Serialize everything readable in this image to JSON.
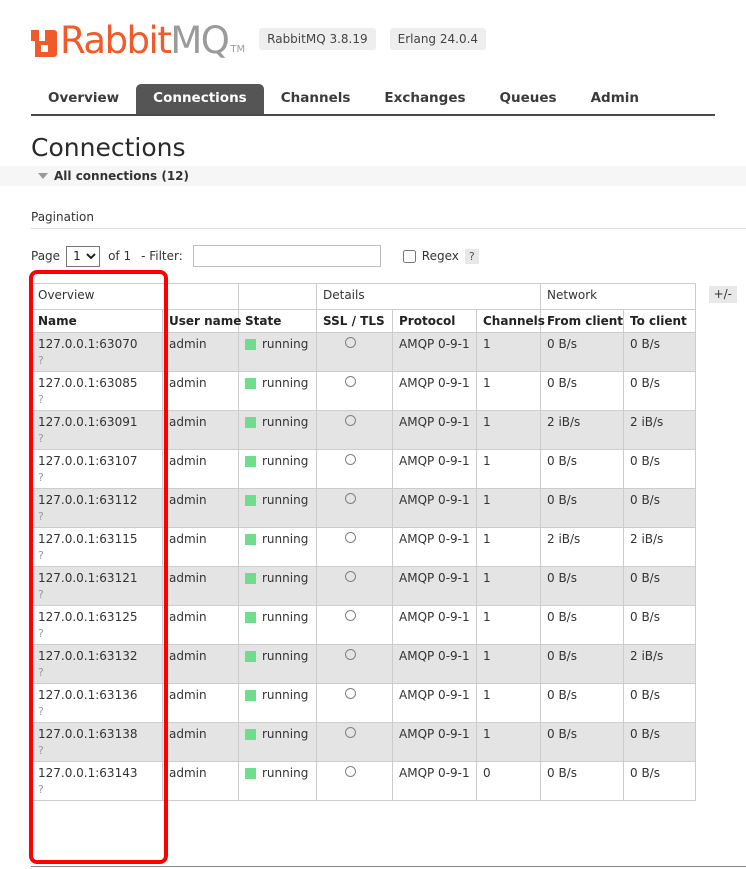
{
  "header": {
    "logo_rabbit": "Rabbit",
    "logo_mq": "MQ",
    "logo_tm": "TM",
    "badges": [
      {
        "name": "rabbitmq-version-badge",
        "label": "RabbitMQ 3.8.19"
      },
      {
        "name": "erlang-version-badge",
        "label": "Erlang 24.0.4"
      }
    ],
    "brand_color": "#f15a2b"
  },
  "nav": {
    "tabs": [
      {
        "label": "Overview",
        "active": false
      },
      {
        "label": "Connections",
        "active": true
      },
      {
        "label": "Channels",
        "active": false
      },
      {
        "label": "Exchanges",
        "active": false
      },
      {
        "label": "Queues",
        "active": false
      },
      {
        "label": "Admin",
        "active": false
      }
    ],
    "active_tab": "Connections"
  },
  "page": {
    "title": "Connections",
    "section_label": "All connections (12)",
    "connection_count": 12
  },
  "pagination": {
    "heading": "Pagination",
    "page_label": "Page",
    "page_value": "1",
    "page_options": [
      "1"
    ],
    "of_label": "of 1",
    "total_pages": 1,
    "filter_label": "- Filter:",
    "filter_value": "",
    "filter_placeholder": "",
    "regex_label": "Regex",
    "regex_checked": false,
    "help_label": "?"
  },
  "table": {
    "group_headers": [
      {
        "label": "Overview",
        "span": 3
      },
      {
        "label": "Details",
        "span": 3
      },
      {
        "label": "Network",
        "span": 2
      }
    ],
    "columns": [
      "Name",
      "User name",
      "State",
      "SSL / TLS",
      "Protocol",
      "Channels",
      "From client",
      "To client"
    ],
    "toggle_columns_label": "+/-",
    "row_detail_link": "?",
    "state_color": "#6fdd8b",
    "rows": [
      {
        "name": "127.0.0.1:63070",
        "user_name": "admin",
        "state": "running",
        "ssl_tls": "",
        "protocol": "AMQP 0-9-1",
        "channels": "1",
        "from_client": "0 B/s",
        "to_client": "0 B/s"
      },
      {
        "name": "127.0.0.1:63085",
        "user_name": "admin",
        "state": "running",
        "ssl_tls": "",
        "protocol": "AMQP 0-9-1",
        "channels": "1",
        "from_client": "0 B/s",
        "to_client": "0 B/s"
      },
      {
        "name": "127.0.0.1:63091",
        "user_name": "admin",
        "state": "running",
        "ssl_tls": "",
        "protocol": "AMQP 0-9-1",
        "channels": "1",
        "from_client": "2 iB/s",
        "to_client": "2 iB/s"
      },
      {
        "name": "127.0.0.1:63107",
        "user_name": "admin",
        "state": "running",
        "ssl_tls": "",
        "protocol": "AMQP 0-9-1",
        "channels": "1",
        "from_client": "0 B/s",
        "to_client": "0 B/s"
      },
      {
        "name": "127.0.0.1:63112",
        "user_name": "admin",
        "state": "running",
        "ssl_tls": "",
        "protocol": "AMQP 0-9-1",
        "channels": "1",
        "from_client": "0 B/s",
        "to_client": "0 B/s"
      },
      {
        "name": "127.0.0.1:63115",
        "user_name": "admin",
        "state": "running",
        "ssl_tls": "",
        "protocol": "AMQP 0-9-1",
        "channels": "1",
        "from_client": "2 iB/s",
        "to_client": "2 iB/s"
      },
      {
        "name": "127.0.0.1:63121",
        "user_name": "admin",
        "state": "running",
        "ssl_tls": "",
        "protocol": "AMQP 0-9-1",
        "channels": "1",
        "from_client": "0 B/s",
        "to_client": "0 B/s"
      },
      {
        "name": "127.0.0.1:63125",
        "user_name": "admin",
        "state": "running",
        "ssl_tls": "",
        "protocol": "AMQP 0-9-1",
        "channels": "1",
        "from_client": "0 B/s",
        "to_client": "0 B/s"
      },
      {
        "name": "127.0.0.1:63132",
        "user_name": "admin",
        "state": "running",
        "ssl_tls": "",
        "protocol": "AMQP 0-9-1",
        "channels": "1",
        "from_client": "0 B/s",
        "to_client": "2 iB/s"
      },
      {
        "name": "127.0.0.1:63136",
        "user_name": "admin",
        "state": "running",
        "ssl_tls": "",
        "protocol": "AMQP 0-9-1",
        "channels": "1",
        "from_client": "0 B/s",
        "to_client": "0 B/s"
      },
      {
        "name": "127.0.0.1:63138",
        "user_name": "admin",
        "state": "running",
        "ssl_tls": "",
        "protocol": "AMQP 0-9-1",
        "channels": "1",
        "from_client": "0 B/s",
        "to_client": "0 B/s"
      },
      {
        "name": "127.0.0.1:63143",
        "user_name": "admin",
        "state": "running",
        "ssl_tls": "",
        "protocol": "AMQP 0-9-1",
        "channels": "0",
        "from_client": "0 B/s",
        "to_client": "0 B/s"
      }
    ]
  },
  "annotation": {
    "color": "#ff0000",
    "target": "name-column"
  }
}
